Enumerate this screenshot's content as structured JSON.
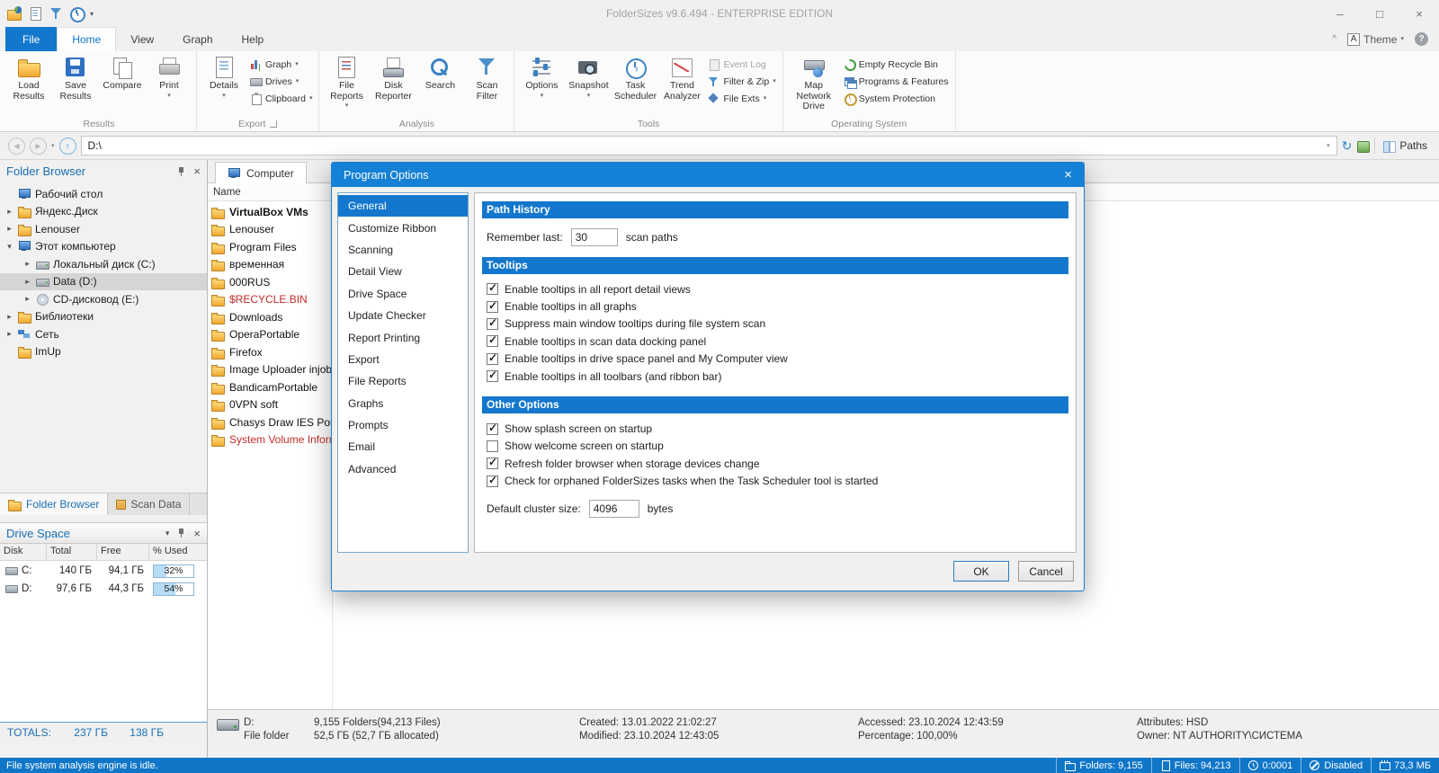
{
  "titlebar": {
    "title": "FolderSizes v9.6.494 - ENTERPRISE EDITION",
    "minimize": "–",
    "maximize": "□",
    "close": "×"
  },
  "icons": {
    "chevron_down": "▾",
    "chevron_up": "^",
    "close": "×",
    "check": "✓",
    "back": "◀",
    "forward": "▶",
    "up": "↑",
    "refresh": "↻",
    "help": "?",
    "theme_letter": "A"
  },
  "menu": {
    "tabs": [
      "File",
      "Home",
      "View",
      "Graph",
      "Help"
    ],
    "theme_label": "Theme"
  },
  "ribbon": {
    "groups": [
      {
        "label": "Results",
        "items": [
          {
            "label": "Load Results"
          },
          {
            "label": "Save Results"
          },
          {
            "label": "Compare"
          },
          {
            "label": "Print",
            "chevron": true
          }
        ]
      },
      {
        "label": "Export",
        "items": [
          {
            "label": "Details",
            "chevron": true
          },
          {
            "label": "Graph",
            "chevron": true
          },
          {
            "label": "Drives",
            "chevron": true
          },
          {
            "label": "Clipboard",
            "chevron": true
          }
        ]
      },
      {
        "label": "Analysis",
        "items": [
          {
            "label": "File Reports",
            "chevron": true
          },
          {
            "label": "Disk Reporter"
          },
          {
            "label": "Search"
          },
          {
            "label": "Scan Filter"
          }
        ]
      },
      {
        "label": "Tools",
        "items": [
          {
            "label": "Options",
            "chevron": true
          },
          {
            "label": "Snapshot",
            "chevron": true
          },
          {
            "label": "Task Scheduler"
          },
          {
            "label": "Trend Analyzer"
          },
          {
            "label": "Event Log",
            "disabled": true
          },
          {
            "label": "Filter & Zip",
            "chevron": true
          },
          {
            "label": "File Exts",
            "chevron": true
          }
        ]
      },
      {
        "label": "Operating System",
        "items": [
          {
            "label": "Map Network Drive"
          },
          {
            "label": "Empty Recycle Bin"
          },
          {
            "label": "Programs & Features"
          },
          {
            "label": "System Protection"
          }
        ]
      }
    ]
  },
  "address": {
    "value": "D:\\",
    "paths_label": "Paths"
  },
  "folder_browser": {
    "title": "Folder Browser",
    "items": [
      {
        "label": "Рабочий стол",
        "caret": "",
        "selected": false
      },
      {
        "label": "Яндекс.Диск",
        "caret": "▸",
        "selected": false
      },
      {
        "label": "Lenouser",
        "caret": "▸",
        "selected": false
      },
      {
        "label": "Этот компьютер",
        "caret": "▾",
        "selected": false
      },
      {
        "label": "Локальный диск (C:)",
        "caret": "▸",
        "selected": false
      },
      {
        "label": "Data (D:)",
        "caret": "▸",
        "selected": true
      },
      {
        "label": "CD-дисковод (E:)",
        "caret": "▸",
        "selected": false
      },
      {
        "label": "Библиотеки",
        "caret": "▸",
        "selected": false
      },
      {
        "label": "Сеть",
        "caret": "▸",
        "selected": false
      },
      {
        "label": "ImUp",
        "caret": "",
        "selected": false
      }
    ],
    "tabs": [
      "Folder Browser",
      "Scan Data"
    ]
  },
  "drive_space": {
    "title": "Drive Space",
    "columns": [
      "Disk",
      "Total",
      "Free",
      "% Used"
    ],
    "rows": [
      {
        "disk": "C:",
        "total": "140 ГБ",
        "free": "94,1 ГБ",
        "used": "32%",
        "fill_style": "width:32%"
      },
      {
        "disk": "D:",
        "total": "97,6 ГБ",
        "free": "44,3 ГБ",
        "used": "54%",
        "fill_style": "width:54%"
      }
    ],
    "totals_label": "TOTALS:",
    "totals_total": "237 ГБ",
    "totals_free": "138 ГБ"
  },
  "main": {
    "tab": "Computer",
    "name_column": "Name",
    "files": [
      {
        "name": "VirtualBox VMs",
        "bold": true,
        "red": false
      },
      {
        "name": "Lenouser",
        "bold": false,
        "red": false
      },
      {
        "name": "Program Files",
        "bold": false,
        "red": false
      },
      {
        "name": "временная",
        "bold": false,
        "red": false
      },
      {
        "name": "000RUS",
        "bold": false,
        "red": false
      },
      {
        "name": "$RECYCLE.BIN",
        "bold": false,
        "red": true
      },
      {
        "name": "Downloads",
        "bold": false,
        "red": false
      },
      {
        "name": "OperaPortable",
        "bold": false,
        "red": false
      },
      {
        "name": "Firefox",
        "bold": false,
        "red": false
      },
      {
        "name": "Image Uploader injob",
        "bold": false,
        "red": false
      },
      {
        "name": "BandicamPortable",
        "bold": false,
        "red": false
      },
      {
        "name": "0VPN soft",
        "bold": false,
        "red": false
      },
      {
        "name": "Chasys Draw IES Portab",
        "bold": false,
        "red": false
      },
      {
        "name": "System Volume Inform",
        "bold": false,
        "red": true
      }
    ]
  },
  "dialog": {
    "title": "Program Options",
    "nav": [
      {
        "label": "General",
        "selected": true
      },
      {
        "label": "Customize Ribbon",
        "selected": false
      },
      {
        "label": "Scanning",
        "selected": false
      },
      {
        "label": "Detail View",
        "selected": false
      },
      {
        "label": "Drive Space",
        "selected": false
      },
      {
        "label": "Update Checker",
        "selected": false
      },
      {
        "label": "Report Printing",
        "selected": false
      },
      {
        "label": "Export",
        "selected": false
      },
      {
        "label": "File Reports",
        "selected": false
      },
      {
        "label": "Graphs",
        "selected": false
      },
      {
        "label": "Prompts",
        "selected": false
      },
      {
        "label": "Email",
        "selected": false
      },
      {
        "label": "Advanced",
        "selected": false
      }
    ],
    "path_history": {
      "title": "Path History",
      "remember_label": "Remember last:",
      "remember_value": "30",
      "remember_suffix": "scan paths"
    },
    "tooltips": {
      "title": "Tooltips",
      "options": [
        {
          "label": "Enable tooltips in all report detail views",
          "checked": true
        },
        {
          "label": "Enable tooltips in all graphs",
          "checked": true
        },
        {
          "label": "Suppress main window tooltips during file system scan",
          "checked": true
        },
        {
          "label": "Enable tooltips in scan data docking panel",
          "checked": true
        },
        {
          "label": "Enable tooltips in drive space panel and My Computer view",
          "checked": true
        },
        {
          "label": "Enable tooltips in all toolbars (and ribbon bar)",
          "checked": true
        }
      ]
    },
    "other": {
      "title": "Other Options",
      "options": [
        {
          "label": "Show splash screen on startup",
          "checked": true
        },
        {
          "label": "Show welcome screen on startup",
          "checked": false
        },
        {
          "label": "Refresh folder browser when storage devices change",
          "checked": true
        },
        {
          "label": "Check for orphaned FolderSizes tasks when the Task Scheduler tool is started",
          "checked": true
        }
      ],
      "cluster_label": "Default cluster size:",
      "cluster_value": "4096",
      "cluster_suffix": "bytes"
    },
    "ok": "OK",
    "cancel": "Cancel"
  },
  "info_bar": {
    "drive": "D:",
    "type": "File folder",
    "folders": "9,155 Folders(94,213 Files)",
    "size": "52,5 ГБ (52,7 ГБ allocated)",
    "created": "Created: 13.01.2022 21:02:27",
    "modified": "Modified: 23.10.2024 12:43:05",
    "accessed": "Accessed: 23.10.2024 12:43:59",
    "percentage": "Percentage: 100,00%",
    "attributes": "Attributes: HSD",
    "owner": "Owner: NT AUTHORITY\\СИСТЕМА"
  },
  "status_bar": {
    "message": "File system analysis engine is idle.",
    "folders": "Folders: 9,155",
    "files": "Files: 94,213",
    "time": "0:0001",
    "state": "Disabled",
    "memory": "73,3 МБ"
  }
}
